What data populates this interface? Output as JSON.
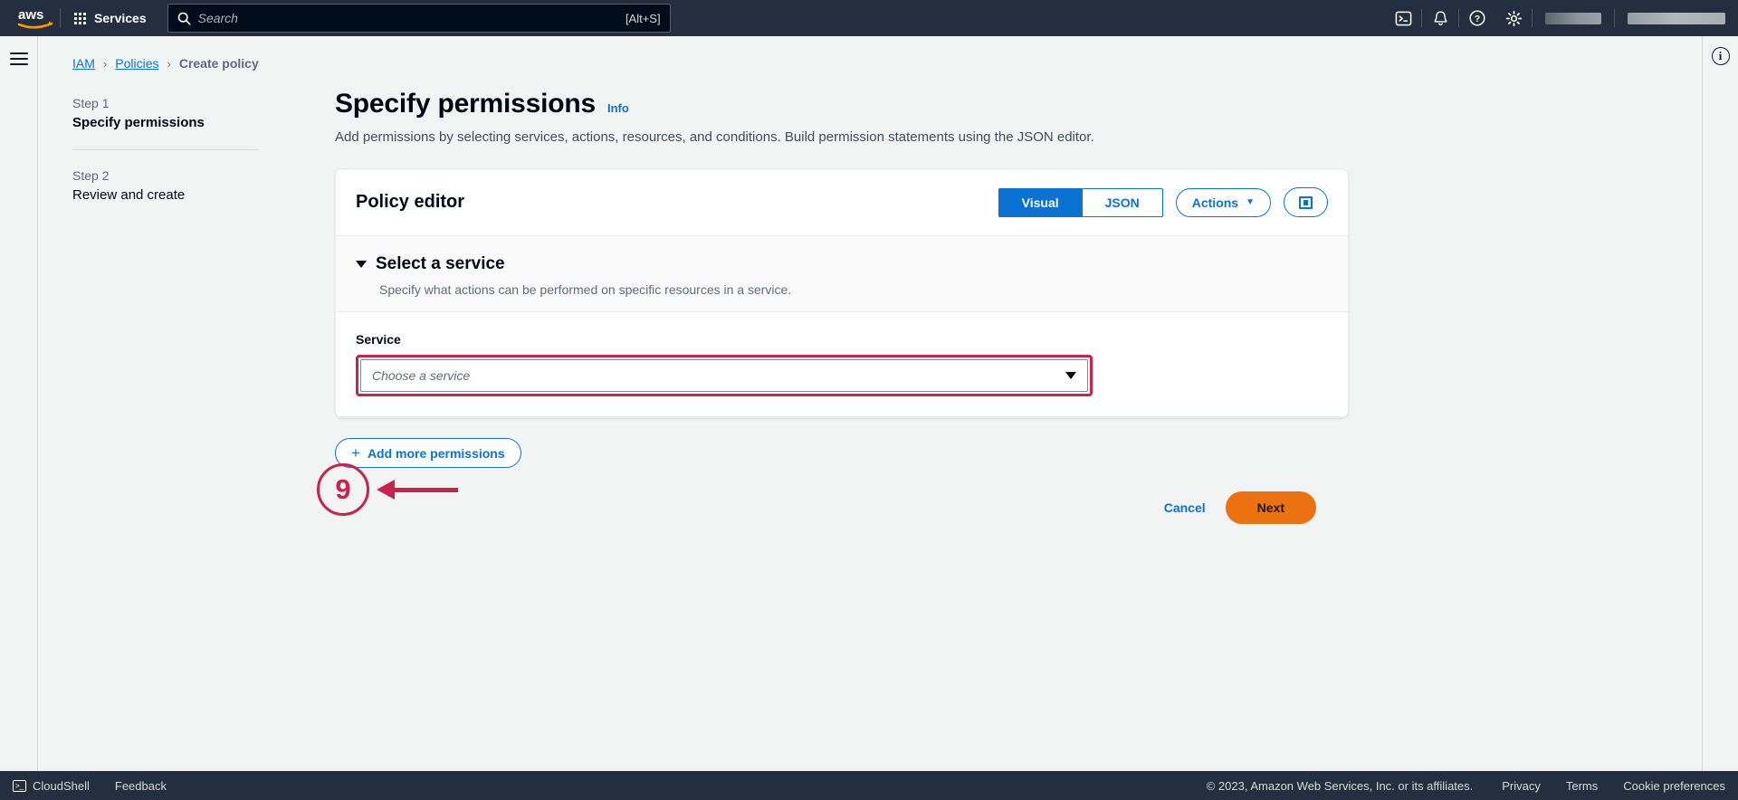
{
  "topnav": {
    "logo_alt": "aws",
    "services_label": "Services",
    "search_placeholder": "Search",
    "search_value": "",
    "search_shortcut": "[Alt+S]",
    "icons": [
      "cloudshell-icon",
      "notifications-bell-icon",
      "help-question-icon",
      "settings-gear-icon"
    ],
    "account_redacted_1": "",
    "account_redacted_2": ""
  },
  "breadcrumb": {
    "items": [
      {
        "label": "IAM",
        "link": true
      },
      {
        "label": "Policies",
        "link": true
      },
      {
        "label": "Create policy",
        "link": false
      }
    ],
    "separator": "›"
  },
  "steps": [
    {
      "number": "Step 1",
      "name": "Specify permissions",
      "active": true
    },
    {
      "number": "Step 2",
      "name": "Review and create",
      "active": false
    }
  ],
  "page": {
    "title": "Specify permissions",
    "info_label": "Info",
    "description": "Add permissions by selecting services, actions, resources, and conditions. Build permission statements using the JSON editor."
  },
  "policy_editor": {
    "title": "Policy editor",
    "modes": [
      {
        "label": "Visual",
        "selected": true
      },
      {
        "label": "JSON",
        "selected": false
      }
    ],
    "actions_label": "Actions",
    "actions_caret": "▼",
    "panel_toggle_name": "split-panel-icon"
  },
  "select_service": {
    "section_title": "Select a service",
    "section_description": "Specify what actions can be performed on specific resources in a service.",
    "collapse_caret": "▼",
    "field_label": "Service",
    "field_placeholder": "Choose a service",
    "field_value": "",
    "dropdown_caret": "▼",
    "highlight_color": "#c9234b"
  },
  "add_more_permissions": {
    "label": "Add more permissions",
    "plus": "+"
  },
  "form_actions": {
    "cancel_label": "Cancel",
    "next_label": "Next",
    "next_color": "#ec7211"
  },
  "annotation": {
    "number": "9",
    "color": "#c9234b"
  },
  "footer": {
    "cloudshell_label": "CloudShell",
    "feedback_label": "Feedback",
    "copyright": "© 2023, Amazon Web Services, Inc. or its affiliates.",
    "links": [
      "Privacy",
      "Terms",
      "Cookie preferences"
    ]
  }
}
